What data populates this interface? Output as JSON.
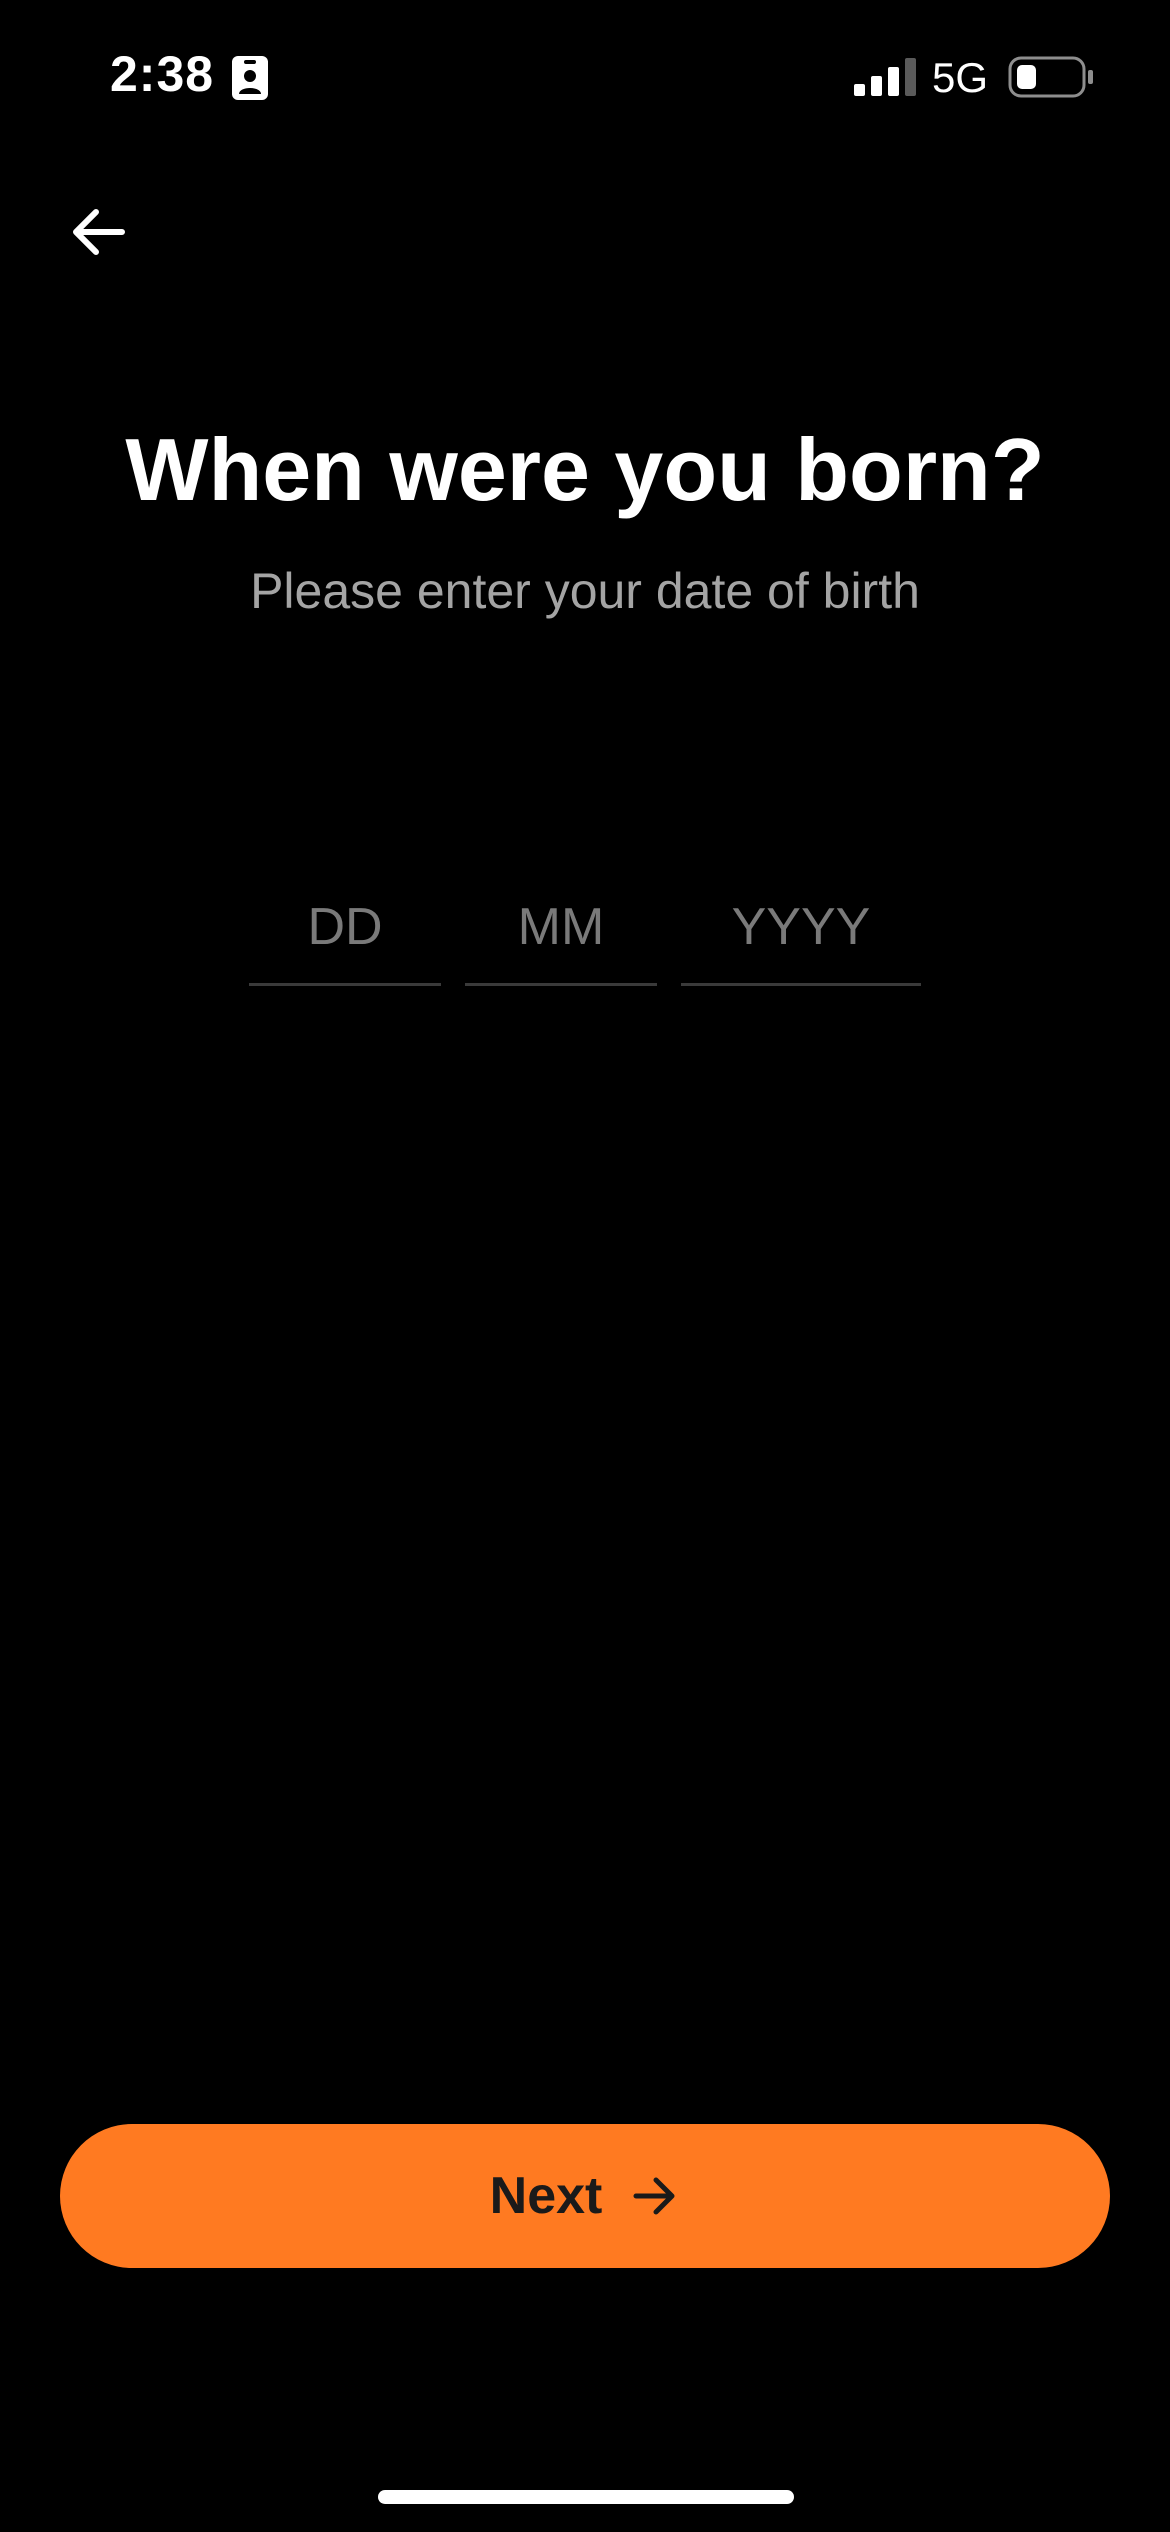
{
  "status_bar": {
    "time": "2:38",
    "network": "5G",
    "icons": [
      "id-badge-icon",
      "signal-icon",
      "battery-icon"
    ]
  },
  "header": {
    "back_icon": "arrow-left-icon"
  },
  "main": {
    "title": "When were you born?",
    "subtitle": "Please enter your date of birth",
    "date_fields": {
      "day": {
        "placeholder": "DD",
        "value": ""
      },
      "month": {
        "placeholder": "MM",
        "value": ""
      },
      "year": {
        "placeholder": "YYYY",
        "value": ""
      }
    }
  },
  "footer": {
    "next_label": "Next",
    "next_icon": "arrow-right-icon"
  },
  "colors": {
    "background": "#000000",
    "accent": "#ff7a21",
    "subtitle": "#a4a4a4",
    "placeholder": "#7a7a7a",
    "underline": "#3a3a3a",
    "button_text": "#1a1a1a"
  }
}
